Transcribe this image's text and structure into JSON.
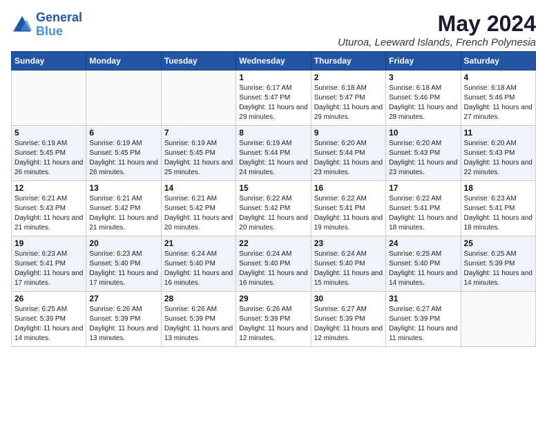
{
  "logo": {
    "line1": "General",
    "line2": "Blue"
  },
  "title": {
    "month_year": "May 2024",
    "location": "Uturoa, Leeward Islands, French Polynesia"
  },
  "weekdays": [
    "Sunday",
    "Monday",
    "Tuesday",
    "Wednesday",
    "Thursday",
    "Friday",
    "Saturday"
  ],
  "weeks": [
    [
      {
        "day": "",
        "info": ""
      },
      {
        "day": "",
        "info": ""
      },
      {
        "day": "",
        "info": ""
      },
      {
        "day": "1",
        "info": "Sunrise: 6:17 AM\nSunset: 5:47 PM\nDaylight: 11 hours and 29 minutes."
      },
      {
        "day": "2",
        "info": "Sunrise: 6:18 AM\nSunset: 5:47 PM\nDaylight: 11 hours and 29 minutes."
      },
      {
        "day": "3",
        "info": "Sunrise: 6:18 AM\nSunset: 5:46 PM\nDaylight: 11 hours and 28 minutes."
      },
      {
        "day": "4",
        "info": "Sunrise: 6:18 AM\nSunset: 5:46 PM\nDaylight: 11 hours and 27 minutes."
      }
    ],
    [
      {
        "day": "5",
        "info": "Sunrise: 6:19 AM\nSunset: 5:45 PM\nDaylight: 11 hours and 26 minutes."
      },
      {
        "day": "6",
        "info": "Sunrise: 6:19 AM\nSunset: 5:45 PM\nDaylight: 11 hours and 26 minutes."
      },
      {
        "day": "7",
        "info": "Sunrise: 6:19 AM\nSunset: 5:45 PM\nDaylight: 11 hours and 25 minutes."
      },
      {
        "day": "8",
        "info": "Sunrise: 6:19 AM\nSunset: 5:44 PM\nDaylight: 11 hours and 24 minutes."
      },
      {
        "day": "9",
        "info": "Sunrise: 6:20 AM\nSunset: 5:44 PM\nDaylight: 11 hours and 23 minutes."
      },
      {
        "day": "10",
        "info": "Sunrise: 6:20 AM\nSunset: 5:43 PM\nDaylight: 11 hours and 23 minutes."
      },
      {
        "day": "11",
        "info": "Sunrise: 6:20 AM\nSunset: 5:43 PM\nDaylight: 11 hours and 22 minutes."
      }
    ],
    [
      {
        "day": "12",
        "info": "Sunrise: 6:21 AM\nSunset: 5:43 PM\nDaylight: 11 hours and 21 minutes."
      },
      {
        "day": "13",
        "info": "Sunrise: 6:21 AM\nSunset: 5:42 PM\nDaylight: 11 hours and 21 minutes."
      },
      {
        "day": "14",
        "info": "Sunrise: 6:21 AM\nSunset: 5:42 PM\nDaylight: 11 hours and 20 minutes."
      },
      {
        "day": "15",
        "info": "Sunrise: 6:22 AM\nSunset: 5:42 PM\nDaylight: 11 hours and 20 minutes."
      },
      {
        "day": "16",
        "info": "Sunrise: 6:22 AM\nSunset: 5:41 PM\nDaylight: 11 hours and 19 minutes."
      },
      {
        "day": "17",
        "info": "Sunrise: 6:22 AM\nSunset: 5:41 PM\nDaylight: 11 hours and 18 minutes."
      },
      {
        "day": "18",
        "info": "Sunrise: 6:23 AM\nSunset: 5:41 PM\nDaylight: 11 hours and 18 minutes."
      }
    ],
    [
      {
        "day": "19",
        "info": "Sunrise: 6:23 AM\nSunset: 5:41 PM\nDaylight: 11 hours and 17 minutes."
      },
      {
        "day": "20",
        "info": "Sunrise: 6:23 AM\nSunset: 5:40 PM\nDaylight: 11 hours and 17 minutes."
      },
      {
        "day": "21",
        "info": "Sunrise: 6:24 AM\nSunset: 5:40 PM\nDaylight: 11 hours and 16 minutes."
      },
      {
        "day": "22",
        "info": "Sunrise: 6:24 AM\nSunset: 5:40 PM\nDaylight: 11 hours and 16 minutes."
      },
      {
        "day": "23",
        "info": "Sunrise: 6:24 AM\nSunset: 5:40 PM\nDaylight: 11 hours and 15 minutes."
      },
      {
        "day": "24",
        "info": "Sunrise: 6:25 AM\nSunset: 5:40 PM\nDaylight: 11 hours and 14 minutes."
      },
      {
        "day": "25",
        "info": "Sunrise: 6:25 AM\nSunset: 5:39 PM\nDaylight: 11 hours and 14 minutes."
      }
    ],
    [
      {
        "day": "26",
        "info": "Sunrise: 6:25 AM\nSunset: 5:39 PM\nDaylight: 11 hours and 14 minutes."
      },
      {
        "day": "27",
        "info": "Sunrise: 6:26 AM\nSunset: 5:39 PM\nDaylight: 11 hours and 13 minutes."
      },
      {
        "day": "28",
        "info": "Sunrise: 6:26 AM\nSunset: 5:39 PM\nDaylight: 11 hours and 13 minutes."
      },
      {
        "day": "29",
        "info": "Sunrise: 6:26 AM\nSunset: 5:39 PM\nDaylight: 11 hours and 12 minutes."
      },
      {
        "day": "30",
        "info": "Sunrise: 6:27 AM\nSunset: 5:39 PM\nDaylight: 11 hours and 12 minutes."
      },
      {
        "day": "31",
        "info": "Sunrise: 6:27 AM\nSunset: 5:39 PM\nDaylight: 11 hours and 11 minutes."
      },
      {
        "day": "",
        "info": ""
      }
    ]
  ]
}
